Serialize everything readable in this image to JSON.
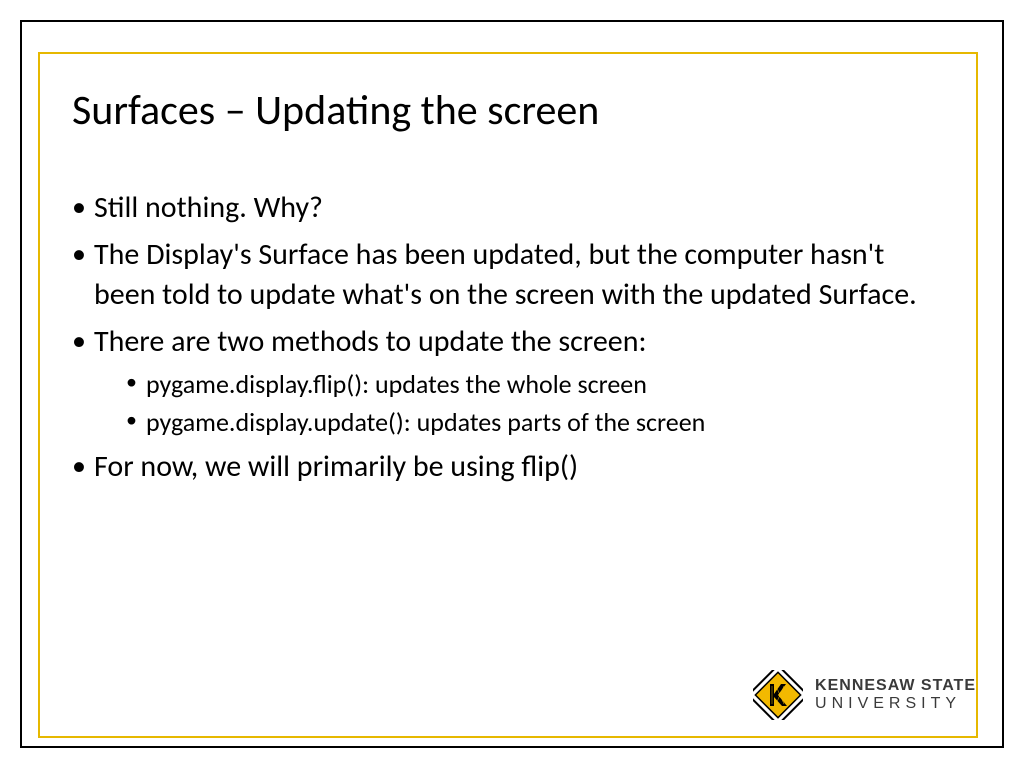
{
  "slide": {
    "title": "Surfaces – Updating the screen",
    "bullets": [
      {
        "text": "Still nothing. Why?"
      },
      {
        "text": "The Display's Surface has been updated, but the computer hasn't been told to update what's on the screen with the updated Surface."
      },
      {
        "text": "There are two methods to update the screen:",
        "sub": [
          "pygame.display.flip(): updates the whole screen",
          "pygame.display.update(): updates parts of the screen"
        ]
      },
      {
        "text": "For now, we will primarily be using flip()"
      }
    ]
  },
  "logo": {
    "line1": "KENNESAW STATE",
    "line2": "UNIVERSITY"
  },
  "colors": {
    "accent": "#e6b800",
    "text": "#000000"
  }
}
